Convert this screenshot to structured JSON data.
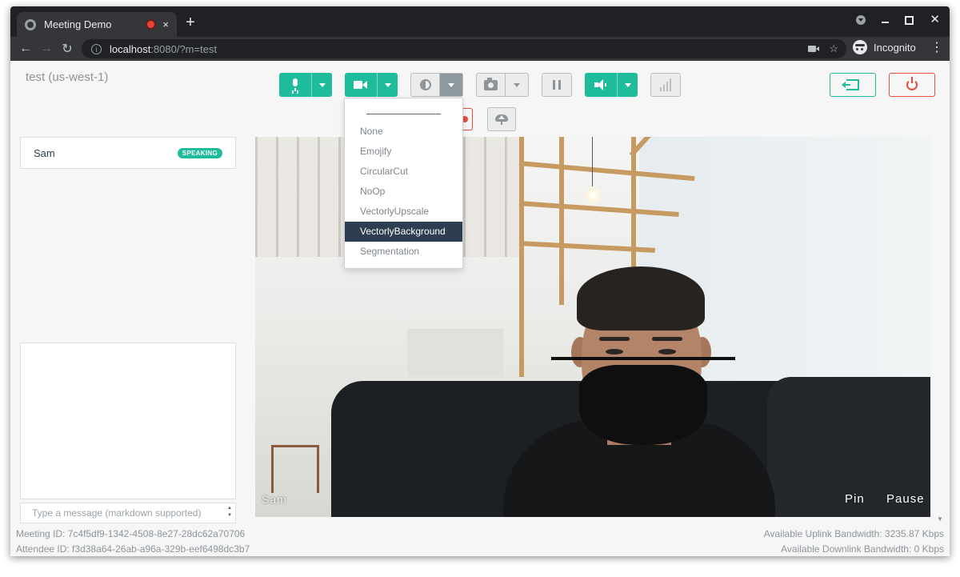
{
  "browser": {
    "tab_title": "Meeting Demo",
    "new_tab": "+",
    "tab_close": "×",
    "back": "←",
    "forward": "→",
    "reload": "↻",
    "url_host": "localhost",
    "url_rest": ":8080/?m=test",
    "bookmark_star": "☆",
    "profile_label": "Incognito",
    "menu": "⋮",
    "close": "✕"
  },
  "app": {
    "room_label": "test (us-west-1)",
    "accent_color": "#1ebc9b",
    "danger_color": "#e74c3c"
  },
  "roster": [
    {
      "name": "Sam",
      "status": "SPEAKING"
    }
  ],
  "chat": {
    "placeholder": "Type a message (markdown supported)",
    "scroll_up": "▲",
    "scroll_down": "▼"
  },
  "video_filter_menu": {
    "items": [
      "None",
      "Emojify",
      "CircularCut",
      "NoOp",
      "VectorlyUpscale",
      "VectorlyBackground",
      "Segmentation"
    ],
    "selected": "VectorlyBackground"
  },
  "video_tile": {
    "attendee_name": "Sam",
    "pin_label": "Pin",
    "pause_label": "Pause"
  },
  "footer": {
    "meeting_id": "Meeting ID: 7c4f5df9-1342-4508-8e27-28dc62a70706",
    "attendee_id": "Attendee ID: f3d38a64-26ab-a96a-329b-eef6498dc3b7",
    "uplink": "Available Uplink Bandwidth: 3235.87 Kbps",
    "downlink": "Available Downlink Bandwidth: 0 Kbps"
  },
  "page_scroll_down": "▼"
}
